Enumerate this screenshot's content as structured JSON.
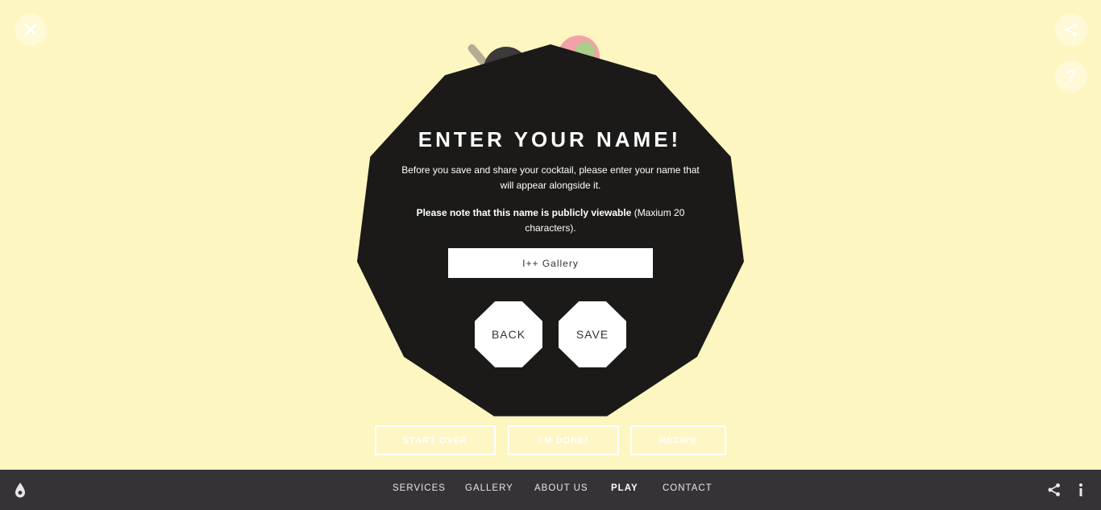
{
  "top_controls": {
    "close_icon": "close-icon",
    "share_icon": "share-icon",
    "help_label": "?"
  },
  "modal": {
    "title": "ENTER YOUR NAME!",
    "text_1": "Before you save and share your cocktail, please enter your name that will appear alongside it.",
    "text_2_bold": "Please note that this name is publicly viewable",
    "text_2_rest": " (Maxium 20 characters).",
    "name_input_value": "I++ Gallery",
    "back_label": "BACK",
    "save_label": "SAVE"
  },
  "actions": {
    "start_over_label": "START OVER",
    "done_label": "I'M DONE!",
    "recipe_label": "RECIPE"
  },
  "footer": {
    "nav": {
      "services": "SERVICES",
      "gallery": "GALLERY",
      "about": "ABOUT US",
      "play": "PLAY",
      "contact": "CONTACT"
    },
    "active_item": "PLAY",
    "logo_icon": "drop-logo-icon",
    "share_icon": "share-icon",
    "info_icon": "info-icon"
  },
  "colors": {
    "background": "#fef6c0",
    "modal": "#1b1a19",
    "footer": "#353336"
  }
}
